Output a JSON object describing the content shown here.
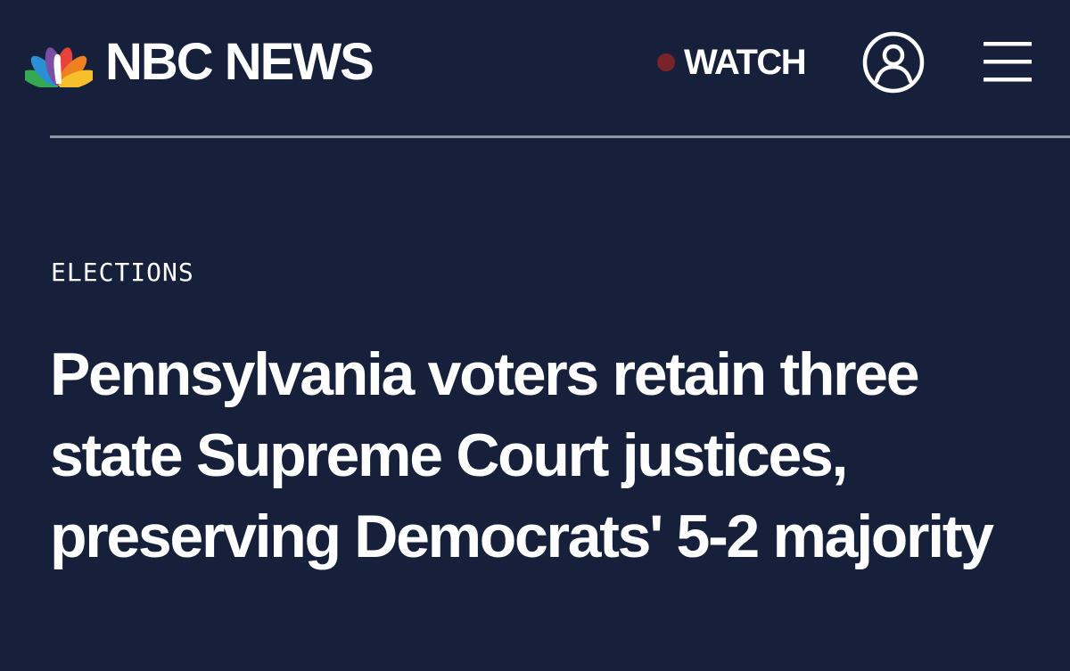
{
  "header": {
    "brand": "NBC NEWS",
    "logo_icon": "nbc-peacock-icon",
    "watch_label": "WATCH",
    "watch_dot_color": "#7a2328",
    "account_icon": "user-account-icon",
    "menu_icon": "hamburger-menu-icon"
  },
  "article": {
    "section": "ELECTIONS",
    "headline": "Pennsylvania voters retain three state Supreme Court justices, preserving Democrats' 5-2 majority"
  },
  "colors": {
    "background": "#17203a",
    "text": "#ffffff",
    "divider": "#8f96a6",
    "peacock": [
      "#f5c02c",
      "#f07f21",
      "#e8403a",
      "#7a4fa3",
      "#2a8fd3",
      "#35a852"
    ]
  }
}
